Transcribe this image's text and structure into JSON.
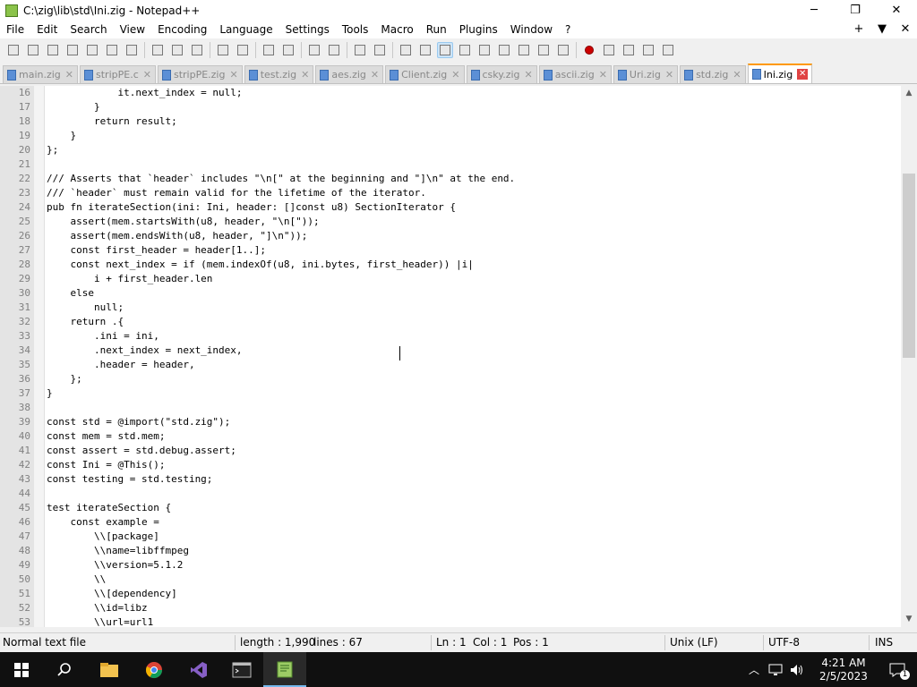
{
  "window": {
    "title": "C:\\zig\\lib\\std\\Ini.zig - Notepad++",
    "minimize_glyph": "─",
    "restore_glyph": "❐",
    "close_glyph": "✕"
  },
  "menu": {
    "items": [
      "File",
      "Edit",
      "Search",
      "View",
      "Encoding",
      "Language",
      "Settings",
      "Tools",
      "Macro",
      "Run",
      "Plugins",
      "Window",
      "?"
    ],
    "right": [
      "+",
      "▼",
      "✕"
    ]
  },
  "tabs": [
    {
      "label": "main.zig",
      "active": false
    },
    {
      "label": "stripPE.c",
      "active": false
    },
    {
      "label": "stripPE.zig",
      "active": false
    },
    {
      "label": "test.zig",
      "active": false
    },
    {
      "label": "aes.zig",
      "active": false
    },
    {
      "label": "Client.zig",
      "active": false
    },
    {
      "label": "csky.zig",
      "active": false
    },
    {
      "label": "ascii.zig",
      "active": false
    },
    {
      "label": "Uri.zig",
      "active": false
    },
    {
      "label": "std.zig",
      "active": false
    },
    {
      "label": "Ini.zig",
      "active": true
    }
  ],
  "editor": {
    "lines": [
      {
        "n": "16",
        "t": "            it.next_index = null;"
      },
      {
        "n": "17",
        "t": "        }"
      },
      {
        "n": "18",
        "t": "        return result;"
      },
      {
        "n": "19",
        "t": "    }"
      },
      {
        "n": "20",
        "t": "};"
      },
      {
        "n": "21",
        "t": ""
      },
      {
        "n": "22",
        "t": "/// Asserts that `header` includes \"\\n[\" at the beginning and \"]\\n\" at the end."
      },
      {
        "n": "23",
        "t": "/// `header` must remain valid for the lifetime of the iterator."
      },
      {
        "n": "24",
        "t": "pub fn iterateSection(ini: Ini, header: []const u8) SectionIterator {"
      },
      {
        "n": "25",
        "t": "    assert(mem.startsWith(u8, header, \"\\n[\"));"
      },
      {
        "n": "26",
        "t": "    assert(mem.endsWith(u8, header, \"]\\n\"));"
      },
      {
        "n": "27",
        "t": "    const first_header = header[1..];"
      },
      {
        "n": "28",
        "t": "    const next_index = if (mem.indexOf(u8, ini.bytes, first_header)) |i|"
      },
      {
        "n": "29",
        "t": "        i + first_header.len"
      },
      {
        "n": "30",
        "t": "    else"
      },
      {
        "n": "31",
        "t": "        null;"
      },
      {
        "n": "32",
        "t": "    return .{"
      },
      {
        "n": "33",
        "t": "        .ini = ini,"
      },
      {
        "n": "34",
        "t": "        .next_index = next_index,"
      },
      {
        "n": "35",
        "t": "        .header = header,"
      },
      {
        "n": "36",
        "t": "    };"
      },
      {
        "n": "37",
        "t": "}"
      },
      {
        "n": "38",
        "t": ""
      },
      {
        "n": "39",
        "t": "const std = @import(\"std.zig\");"
      },
      {
        "n": "40",
        "t": "const mem = std.mem;"
      },
      {
        "n": "41",
        "t": "const assert = std.debug.assert;"
      },
      {
        "n": "42",
        "t": "const Ini = @This();"
      },
      {
        "n": "43",
        "t": "const testing = std.testing;"
      },
      {
        "n": "44",
        "t": ""
      },
      {
        "n": "45",
        "t": "test iterateSection {"
      },
      {
        "n": "46",
        "t": "    const example ="
      },
      {
        "n": "47",
        "t": "        \\\\[package]"
      },
      {
        "n": "48",
        "t": "        \\\\name=libffmpeg"
      },
      {
        "n": "49",
        "t": "        \\\\version=5.1.2"
      },
      {
        "n": "50",
        "t": "        \\\\"
      },
      {
        "n": "51",
        "t": "        \\\\[dependency]"
      },
      {
        "n": "52",
        "t": "        \\\\id=libz"
      },
      {
        "n": "53",
        "t": "        \\\\url=url1"
      }
    ]
  },
  "scrollbar": {
    "up": "▲",
    "down": "▼"
  },
  "status": {
    "filetype": "Normal text file",
    "length": "length : 1,990",
    "lines": "lines : 67",
    "ln": "Ln : 1",
    "col": "Col : 1",
    "pos": "Pos : 1",
    "eol": "Unix (LF)",
    "encoding": "UTF-8",
    "mode": "INS"
  },
  "taskbar": {
    "time": "4:21 AM",
    "date": "2/5/2023",
    "notification_count": "1"
  },
  "colors": {
    "active_tab_accent": "#ff9900",
    "taskbar_bg": "#101010",
    "gutter_bg": "#e4e4e4"
  }
}
